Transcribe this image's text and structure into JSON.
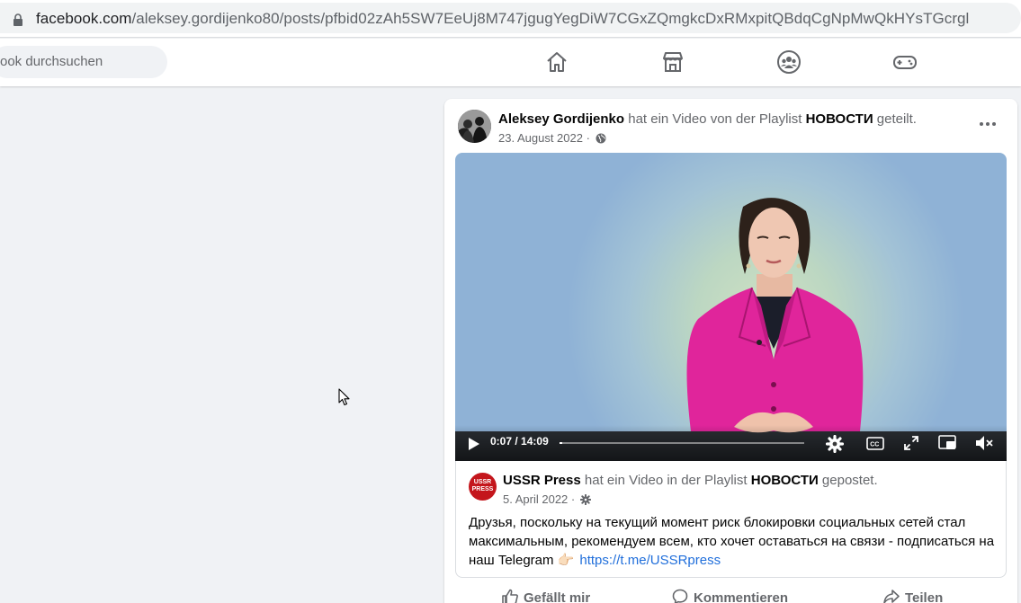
{
  "browser": {
    "url_host": "facebook.com",
    "url_path": "/aleksey.gordijenko80/posts/pfbid02zAh5SW7EeUj8M747jgugYegDiW7CGxZQmgkcDxRMxpitQBdqCgNpMwQkHYsTGcrgl",
    "icon": "lock-icon"
  },
  "nav": {
    "search_placeholder": "ook durchsuchen",
    "icons": [
      "home-icon",
      "marketplace-icon",
      "groups-icon",
      "gaming-icon"
    ]
  },
  "post": {
    "author": "Aleksey Gordijenko",
    "action_text_1": " hat ein Video von der Playlist ",
    "playlist": "НОВОСТИ",
    "action_text_2": " geteilt.",
    "date": "23. August 2022 · ",
    "privacy_icon": "globe-icon",
    "more_icon": "more-icon"
  },
  "video": {
    "time_current": "0:07",
    "time_separator": " / ",
    "time_total": "14:09",
    "progress_fraction": 0.01,
    "controls": [
      "play-icon",
      "settings-icon",
      "captions-icon",
      "fullscreen-icon",
      "pip-icon",
      "mute-icon"
    ]
  },
  "shared": {
    "page_name": "USSR Press",
    "action_text_1": " hat ein Video in der Playlist ",
    "playlist": "НОВОСТИ",
    "action_text_2": " gepostet.",
    "date": "5. April 2022 · ",
    "avatar_text": "USSR PRESS",
    "text": "Друзья, поскольку на текущий момент риск блокировки  социальных сетей стал максимальным, рекомендуем всем, кто хочет оставаться на связи - подписаться на наш Telegram 👉🏻",
    "link": "https://t.me/USSRpress"
  },
  "actions": {
    "like": "Gefällt mir",
    "comment": "Kommentieren",
    "share": "Teilen"
  },
  "colors": {
    "link": "#216fdb",
    "ussr_red": "#c4161c",
    "jacket_pink": "#e0259b"
  }
}
